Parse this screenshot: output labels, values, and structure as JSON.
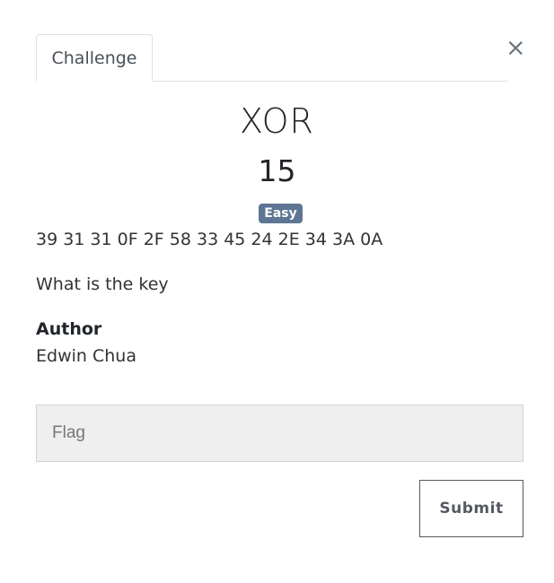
{
  "modal": {
    "close_label": "×",
    "tabs": [
      {
        "label": "Challenge",
        "active": true
      }
    ]
  },
  "challenge": {
    "name": "XOR",
    "points": "15",
    "difficulty": "Easy",
    "difficulty_color": "#5f7594",
    "description_lines": [
      "39 31 31 0F 2F 58 33 45 24 2E 34 3A 0A",
      "What is the key"
    ],
    "author_label": "Author",
    "author_name": "Edwin Chua"
  },
  "form": {
    "flag_placeholder": "Flag",
    "flag_value": "",
    "submit_label": "Submit"
  }
}
